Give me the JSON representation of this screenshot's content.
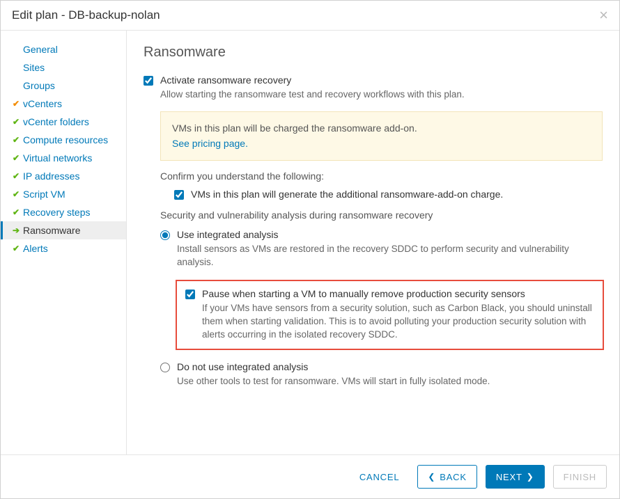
{
  "dialog": {
    "title": "Edit plan - DB-backup-nolan",
    "close_label": "×"
  },
  "sidebar": {
    "items": [
      {
        "label": "General",
        "icon": "",
        "interactable": true
      },
      {
        "label": "Sites",
        "icon": "",
        "interactable": true
      },
      {
        "label": "Groups",
        "icon": "",
        "interactable": true
      },
      {
        "label": "vCenters",
        "icon": "warn",
        "interactable": true
      },
      {
        "label": "vCenter folders",
        "icon": "check",
        "interactable": true
      },
      {
        "label": "Compute resources",
        "icon": "check",
        "interactable": true
      },
      {
        "label": "Virtual networks",
        "icon": "check",
        "interactable": true
      },
      {
        "label": "IP addresses",
        "icon": "check",
        "interactable": true
      },
      {
        "label": "Script VM",
        "icon": "check",
        "interactable": true
      },
      {
        "label": "Recovery steps",
        "icon": "check",
        "interactable": true
      },
      {
        "label": "Ransomware",
        "icon": "arrow",
        "interactable": true,
        "active": true
      },
      {
        "label": "Alerts",
        "icon": "check",
        "interactable": true
      }
    ]
  },
  "page": {
    "title": "Ransomware",
    "activate": {
      "label": "Activate ransomware recovery",
      "checked": true,
      "desc": "Allow starting the ransomware test and recovery workflows with this plan."
    },
    "info": {
      "line1": "VMs in this plan will be charged the ransomware add-on.",
      "link": "See pricing page."
    },
    "confirm_heading": "Confirm you understand the following:",
    "confirm_check": {
      "label": "VMs in this plan will generate the additional ransomware-add-on charge.",
      "checked": true
    },
    "analysis_heading": "Security and vulnerability analysis during ransomware recovery",
    "options": {
      "integrated": {
        "label": "Use integrated analysis",
        "selected": true,
        "desc": "Install sensors as VMs are restored in the recovery SDDC to perform security and vulnerability analysis.",
        "pause": {
          "label": "Pause when starting a VM to manually remove production security sensors",
          "checked": true,
          "desc": "If your VMs have sensors from a security solution, such as Carbon Black, you should uninstall them when starting validation. This is to avoid polluting your production security solution with alerts occurring in the isolated recovery SDDC."
        }
      },
      "no_integrated": {
        "label": "Do not use integrated analysis",
        "selected": false,
        "desc": "Use other tools to test for ransomware. VMs will start in fully isolated mode."
      }
    }
  },
  "footer": {
    "cancel": "CANCEL",
    "back": "BACK",
    "next": "NEXT",
    "finish": "FINISH"
  }
}
